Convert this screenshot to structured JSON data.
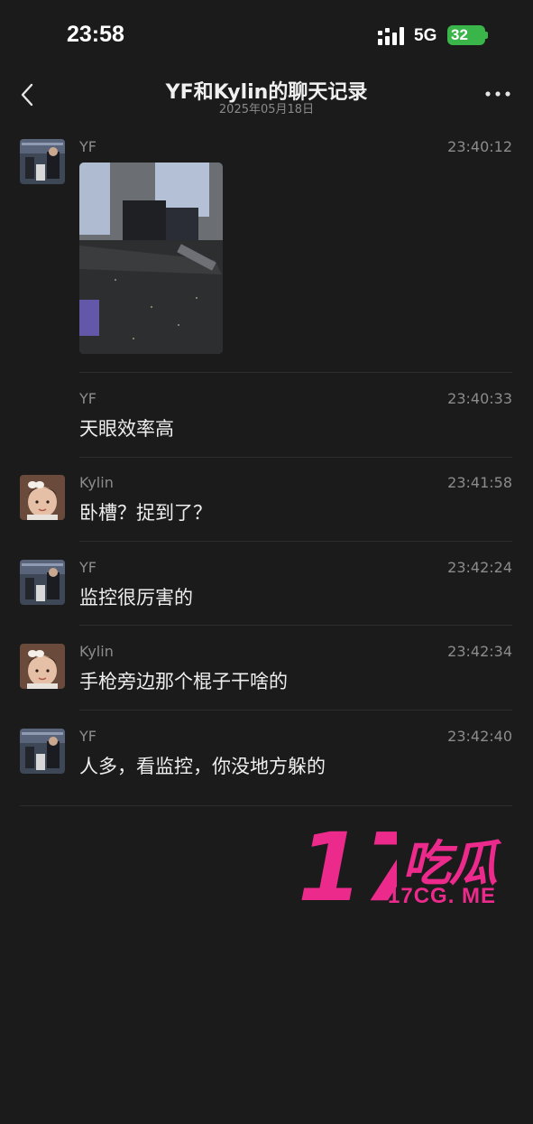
{
  "status_bar": {
    "time": "23:58",
    "network": "5G",
    "battery": "32"
  },
  "header": {
    "title": "YF和Kylin的聊天记录",
    "date": "2025年05月18日"
  },
  "messages": [
    {
      "sender": "YF",
      "time": "23:40:12",
      "type": "image"
    },
    {
      "sender": "YF",
      "time": "23:40:33",
      "text": "天眼效率高"
    },
    {
      "sender": "Kylin",
      "time": "23:41:58",
      "text": "卧槽？捉到了？"
    },
    {
      "sender": "YF",
      "time": "23:42:24",
      "text": "监控很厉害的"
    },
    {
      "sender": "Kylin",
      "time": "23:42:34",
      "text": "手枪旁边那个棍子干啥的"
    },
    {
      "sender": "YF",
      "time": "23:42:40",
      "text": "人多，看监控，你没地方躲的"
    }
  ],
  "watermark": {
    "number": "17",
    "chinese": "吃瓜",
    "url": "17CG. ME",
    "color": "#ec2a8c"
  },
  "colors": {
    "background": "#1b1b1b",
    "battery": "#39b54a"
  },
  "icons": [
    "back-icon",
    "more-icon",
    "signal-icon"
  ]
}
